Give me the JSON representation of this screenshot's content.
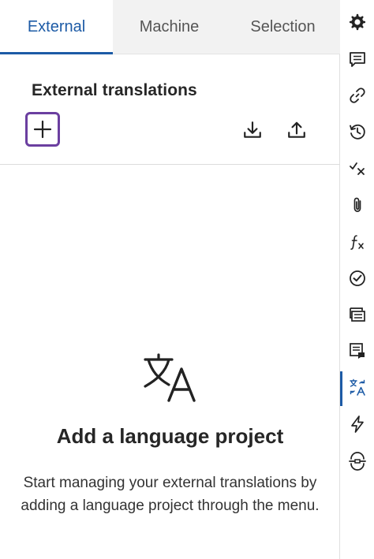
{
  "tabs": [
    {
      "label": "External",
      "active": true
    },
    {
      "label": "Machine",
      "active": false
    },
    {
      "label": "Selection",
      "active": false
    }
  ],
  "section": {
    "title": "External translations"
  },
  "toolbar": {
    "add_icon": "plus-icon",
    "download_icon": "download-icon",
    "upload_icon": "upload-icon"
  },
  "empty_state": {
    "icon": "translate-icon",
    "title": "Add a language project",
    "description": "Start managing your external translations by adding a language project through the menu."
  },
  "rail": {
    "items": [
      {
        "icon": "gear-icon"
      },
      {
        "icon": "comment-icon"
      },
      {
        "icon": "link-icon"
      },
      {
        "icon": "history-icon"
      },
      {
        "icon": "spellcheck-icon"
      },
      {
        "icon": "paperclip-icon"
      },
      {
        "icon": "function-icon"
      },
      {
        "icon": "check-circle-icon"
      },
      {
        "icon": "cards-icon"
      },
      {
        "icon": "note-icon"
      },
      {
        "icon": "translate-icon",
        "active": true
      },
      {
        "icon": "lightning-icon"
      },
      {
        "icon": "merge-icon"
      }
    ]
  },
  "colors": {
    "accent": "#1d5ba6",
    "focus": "#6b3fa0",
    "text": "#262626",
    "tab_bg": "#f2f2f2"
  }
}
